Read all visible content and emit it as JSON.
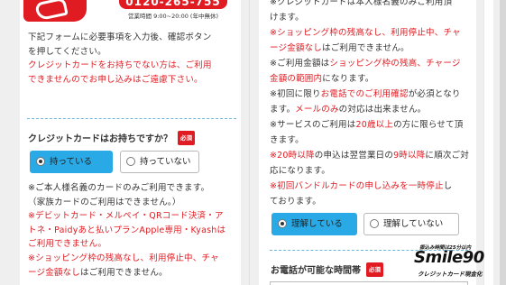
{
  "header": {
    "phone": "0120-265-755",
    "hours": "営業時間 9:00~20:00 (年中無休)"
  },
  "left": {
    "intro": [
      "下記フォームに必要事項を入力後、確認ボタン",
      "を押してください。"
    ],
    "intro_red": [
      "クレジットカードをお持ちでない方は、ご利用",
      "できませんのでお申し込みはご遠慮下さい。"
    ],
    "question": "クレジットカードはお持ちですか？",
    "required": "必須",
    "options": [
      {
        "label": "持っている",
        "selected": true
      },
      {
        "label": "持っていない",
        "selected": false
      }
    ],
    "notes": [
      {
        "text": "※ご本人様名義のカードのみご利用できます。",
        "red": false
      },
      {
        "text": "（家族カードのご利用はできません。）",
        "red": false
      },
      {
        "text": "※デビットカード・メルペイ・QRコード決済・ア",
        "red": true
      },
      {
        "text": "トネ・Paidyあと払いプランApple専用・Kyashは",
        "red": true
      },
      {
        "text": "ご利用できません。",
        "red": true
      },
      {
        "text": "※ショッピング枠の残高なし、利用停止中、チャ",
        "red": true
      },
      {
        "text": "ージ金額なしはご利用できません。",
        "red": false
      }
    ]
  },
  "right": {
    "lines": [
      {
        "segments": [
          {
            "t": "※クレジットカードは本人様名義のみご利用頂",
            "red": false
          }
        ]
      },
      {
        "segments": [
          {
            "t": "けます。",
            "red": false
          }
        ]
      },
      {
        "segments": [
          {
            "t": "※ショッピング枠の残高なし、利用停止中、チャ",
            "red": true
          }
        ]
      },
      {
        "segments": [
          {
            "t": "ージ金額なし",
            "red": true
          },
          {
            "t": "はご利用できません。",
            "red": false
          }
        ]
      },
      {
        "segments": [
          {
            "t": "※ご利用金額は",
            "red": false
          },
          {
            "t": "ショッピング枠の残高、チャージ",
            "red": true
          }
        ]
      },
      {
        "segments": [
          {
            "t": "金額の範囲内",
            "red": true
          },
          {
            "t": "になります。",
            "red": false
          }
        ]
      },
      {
        "segments": [
          {
            "t": "※初回に限り",
            "red": false
          },
          {
            "t": "お電話でのご利用確認",
            "red": true
          },
          {
            "t": "が必須となり",
            "red": false
          }
        ]
      },
      {
        "segments": [
          {
            "t": "ます。",
            "red": false
          },
          {
            "t": "メールのみ",
            "red": true
          },
          {
            "t": "の対応は出来ません。",
            "red": false
          }
        ]
      },
      {
        "segments": [
          {
            "t": "※サービスのご利用は",
            "red": false
          },
          {
            "t": "20歳以上",
            "red": true
          },
          {
            "t": "の方に限らせて頂",
            "red": false
          }
        ]
      },
      {
        "segments": [
          {
            "t": "きます。",
            "red": false
          }
        ]
      },
      {
        "segments": [
          {
            "t": "※20時以降",
            "red": true
          },
          {
            "t": "の申込は翌営業日の",
            "red": false
          },
          {
            "t": "9時以降",
            "red": true
          },
          {
            "t": "に順次ご対",
            "red": false
          }
        ]
      },
      {
        "segments": [
          {
            "t": "応になります。",
            "red": false
          }
        ]
      },
      {
        "segments": [
          {
            "t": "※初回バンドルカードの申し込みを一時停止",
            "red": true
          },
          {
            "t": "し",
            "red": false
          }
        ]
      },
      {
        "segments": [
          {
            "t": "ております。",
            "red": false
          }
        ]
      }
    ],
    "options": [
      {
        "label": "理解している",
        "selected": true
      },
      {
        "label": "理解していない",
        "selected": false
      }
    ],
    "question": "お電話が可能な時間帯",
    "required": "必須"
  },
  "logo": {
    "top": "振込み時間は25分以内",
    "main": "Smile90",
    "sub": "クレジットカード現金化"
  }
}
